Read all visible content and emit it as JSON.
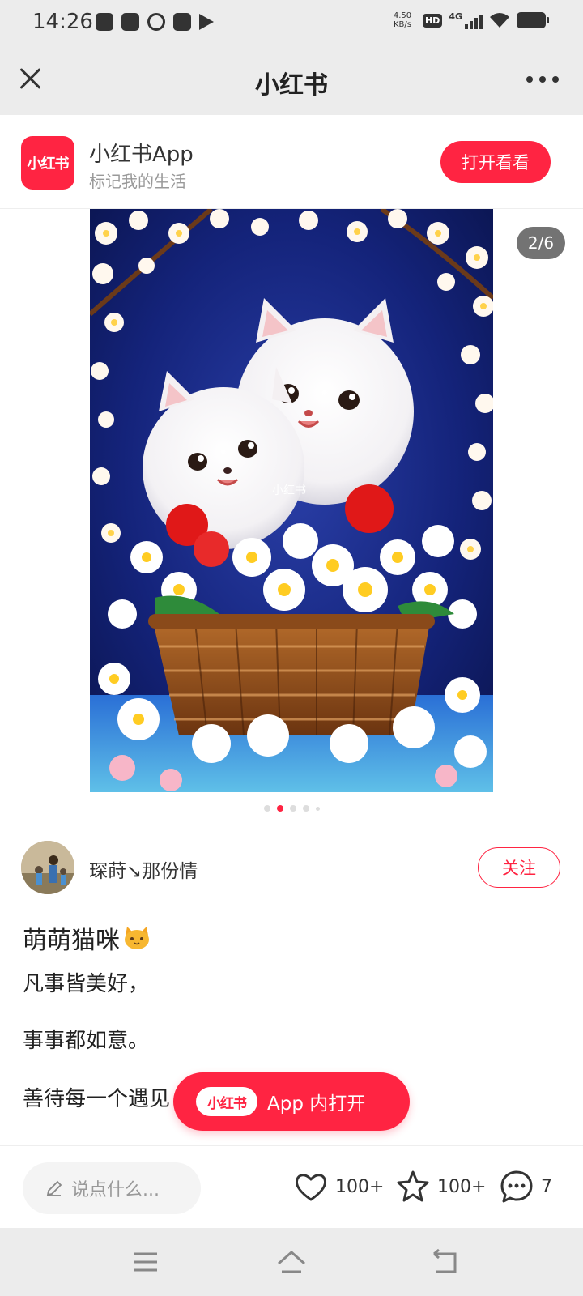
{
  "status_bar": {
    "time": "14:26",
    "net_speed_value": "4.50",
    "net_speed_unit": "KB/s",
    "hd": "HD",
    "network": "4G"
  },
  "title_bar": {
    "title": "小红书"
  },
  "app_banner": {
    "logo_text": "小红书",
    "app_name": "小红书App",
    "slogan": "标记我的生活",
    "open_label": "打开看看"
  },
  "carousel": {
    "counter": "2/6",
    "current_index": 2,
    "image_watermark": "小红书",
    "image_description": "two white fluffy kittens in a wicker basket of daisies"
  },
  "author": {
    "name": "琛莳↘那份情",
    "follow_label": "关注"
  },
  "note": {
    "title": "萌萌猫咪",
    "lines": [
      "凡事皆美好，",
      "事事都如意。",
      "善待每一个遇见"
    ]
  },
  "float_button": {
    "logo_text": "小红书",
    "label": "App 内打开"
  },
  "action_bar": {
    "comment_placeholder": "说点什么...",
    "likes": "100+",
    "collects": "100+",
    "comments": "7"
  },
  "colors": {
    "brand": "#ff2442",
    "background": "#ffffff",
    "chrome": "#ececec"
  }
}
